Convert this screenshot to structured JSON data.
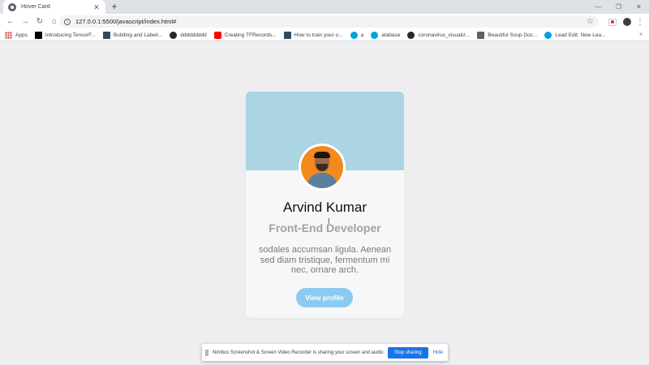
{
  "browser": {
    "tab_title": "Hover Card",
    "new_tab_symbol": "+",
    "url": "127.0.0.1:5500/javascript/index.html#",
    "window_controls": [
      "—",
      "❐",
      "✕"
    ],
    "nav": {
      "back": "←",
      "forward": "→",
      "reload": "↻",
      "home": "⌂"
    }
  },
  "bookmarks": [
    {
      "label": "Apps",
      "icon": "apps-grid-icon"
    },
    {
      "label": "Introducing TensorF...",
      "icon": "medium-icon"
    },
    {
      "label": "Building and Labeli...",
      "icon": "site-icon"
    },
    {
      "label": "ddddddddd",
      "icon": "github-icon"
    },
    {
      "label": "Creating TFRecords...",
      "icon": "youtube-icon"
    },
    {
      "label": "How to train your o...",
      "icon": "site-icon"
    },
    {
      "label": "a",
      "icon": "salesforce-icon"
    },
    {
      "label": "atabase",
      "icon": "salesforce-icon"
    },
    {
      "label": "coronavirus_visualiz...",
      "icon": "github-icon"
    },
    {
      "label": "Beautiful Soup Doc...",
      "icon": "doc-icon"
    },
    {
      "label": "Lead Edit: New Lea...",
      "icon": "salesforce-icon"
    }
  ],
  "bookmarks_more": "»",
  "card": {
    "name": "Arvind Kumar",
    "role": "Front-End Developer",
    "bio": "sodales accumsan ligula. Aenean sed diam tristique, fermentum mi nec, ornare arch.",
    "button_label": "View profile"
  },
  "share_bar": {
    "message": "Nimbus Screenshot & Screen Video Recorder is sharing your screen and audio.",
    "stop_label": "Stop sharing",
    "hide_label": "Hide"
  },
  "colors": {
    "banner": "#abd5e2",
    "button": "#8ccbef",
    "avatar_bg": "#f4891e",
    "page_bg": "#eeeef1"
  }
}
